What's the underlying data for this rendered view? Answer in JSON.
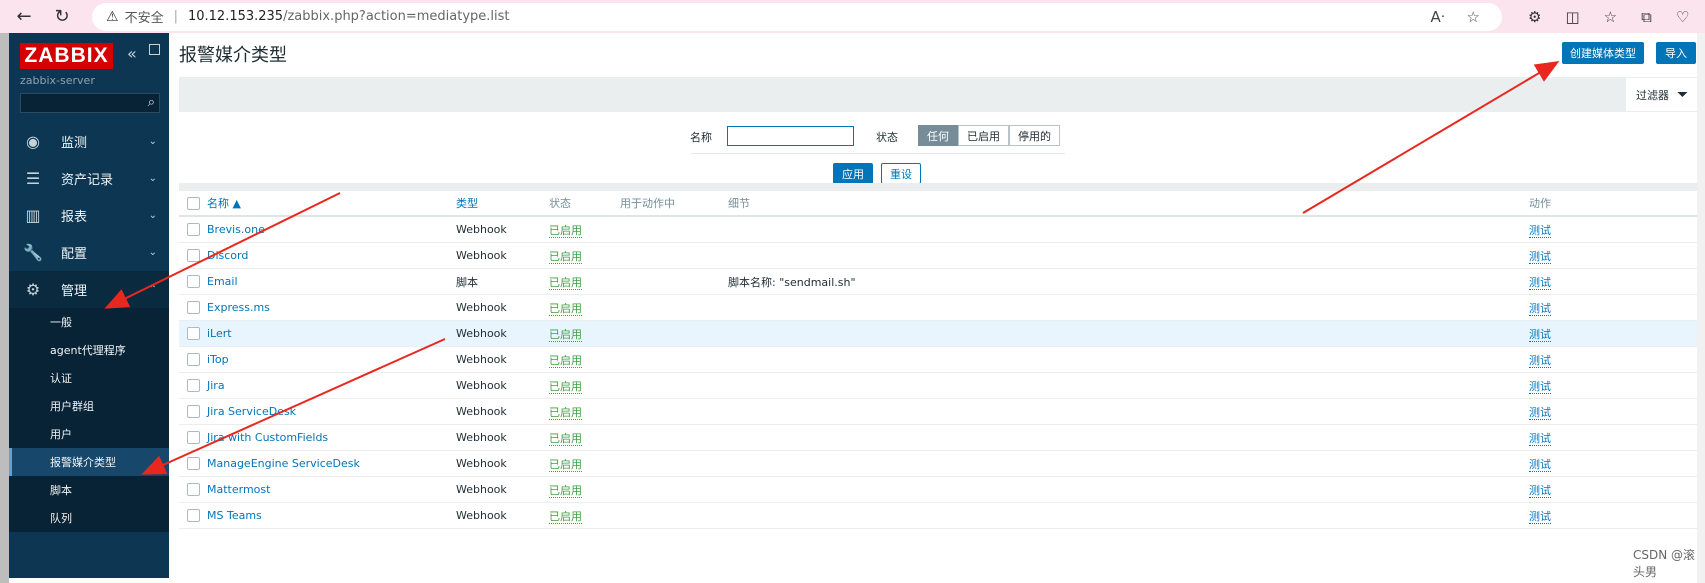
{
  "browser": {
    "not_secure": "不安全",
    "url_host": "10.12.153.235",
    "url_path": "/zabbix.php?action=mediatype.list"
  },
  "sidebar": {
    "logo": "ZABBIX",
    "server": "zabbix-server",
    "search_placeholder": "",
    "menu": [
      {
        "label": "监测",
        "icon": "eye-icon"
      },
      {
        "label": "资产记录",
        "icon": "list-icon"
      },
      {
        "label": "报表",
        "icon": "bar-chart-icon"
      },
      {
        "label": "配置",
        "icon": "wrench-icon"
      },
      {
        "label": "管理",
        "icon": "gear-icon"
      }
    ],
    "submenu": [
      "一般",
      "agent代理程序",
      "认证",
      "用户群组",
      "用户",
      "报警媒介类型",
      "脚本",
      "队列"
    ]
  },
  "header": {
    "title": "报警媒介类型",
    "create_label": "创建媒体类型",
    "import_label": "导入"
  },
  "filter": {
    "tab_label": "过滤器",
    "name_label": "名称",
    "name_value": "",
    "status_label": "状态",
    "status_options": [
      "任何",
      "已启用",
      "停用的"
    ],
    "apply_label": "应用",
    "reset_label": "重设"
  },
  "table": {
    "columns": [
      "名称 ▲",
      "类型",
      "状态",
      "用于动作中",
      "细节",
      "动作"
    ],
    "rows": [
      {
        "name": "Brevis.one",
        "type": "Webhook",
        "status": "已启用",
        "details": "",
        "action": "测试"
      },
      {
        "name": "Discord",
        "type": "Webhook",
        "status": "已启用",
        "details": "",
        "action": "测试"
      },
      {
        "name": "Email",
        "type": "脚本",
        "status": "已启用",
        "details": "脚本名称: \"sendmail.sh\"",
        "action": "测试"
      },
      {
        "name": "Express.ms",
        "type": "Webhook",
        "status": "已启用",
        "details": "",
        "action": "测试"
      },
      {
        "name": "iLert",
        "type": "Webhook",
        "status": "已启用",
        "details": "",
        "action": "测试"
      },
      {
        "name": "iTop",
        "type": "Webhook",
        "status": "已启用",
        "details": "",
        "action": "测试"
      },
      {
        "name": "Jira",
        "type": "Webhook",
        "status": "已启用",
        "details": "",
        "action": "测试"
      },
      {
        "name": "Jira ServiceDesk",
        "type": "Webhook",
        "status": "已启用",
        "details": "",
        "action": "测试"
      },
      {
        "name": "Jira with CustomFields",
        "type": "Webhook",
        "status": "已启用",
        "details": "",
        "action": "测试"
      },
      {
        "name": "ManageEngine ServiceDesk",
        "type": "Webhook",
        "status": "已启用",
        "details": "",
        "action": "测试"
      },
      {
        "name": "Mattermost",
        "type": "Webhook",
        "status": "已启用",
        "details": "",
        "action": "测试"
      },
      {
        "name": "MS Teams",
        "type": "Webhook",
        "status": "已启用",
        "details": "",
        "action": "测试"
      }
    ]
  },
  "watermark": "CSDN @滚头男",
  "colors": {
    "accent": "#0275b8",
    "sidebar": "#0c3651",
    "logo": "#d40000",
    "enabled": "#429e47",
    "arrow": "#e8281f"
  }
}
